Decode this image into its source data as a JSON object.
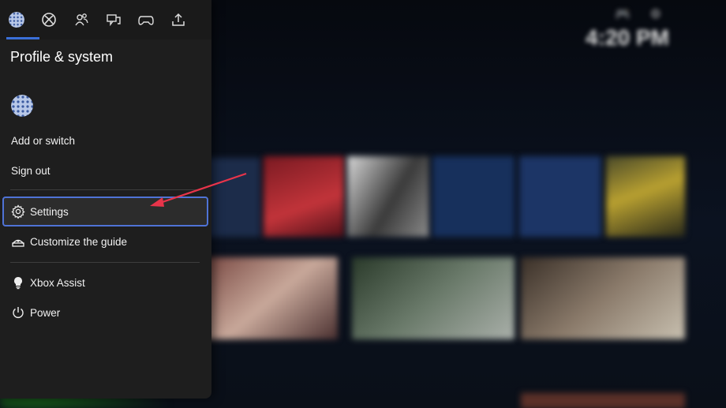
{
  "background": {
    "status_icons": "🎮 ⚙",
    "time": "4:20 PM"
  },
  "guide": {
    "tabs": [
      {
        "icon": "profile-avatar-icon",
        "active": true
      },
      {
        "icon": "xbox-logo-icon",
        "active": false
      },
      {
        "icon": "people-icon",
        "active": false
      },
      {
        "icon": "chat-icon",
        "active": false
      },
      {
        "icon": "controller-icon",
        "active": false
      },
      {
        "icon": "share-upload-icon",
        "active": false
      }
    ],
    "title": "Profile & system",
    "items": {
      "add_switch": "Add or switch",
      "sign_out": "Sign out",
      "settings": "Settings",
      "customize": "Customize the guide",
      "assist": "Xbox Assist",
      "power": "Power"
    }
  },
  "colors": {
    "accent": "#4f73d6",
    "arrow": "#e8344a",
    "panel": "#1e1e1e"
  }
}
